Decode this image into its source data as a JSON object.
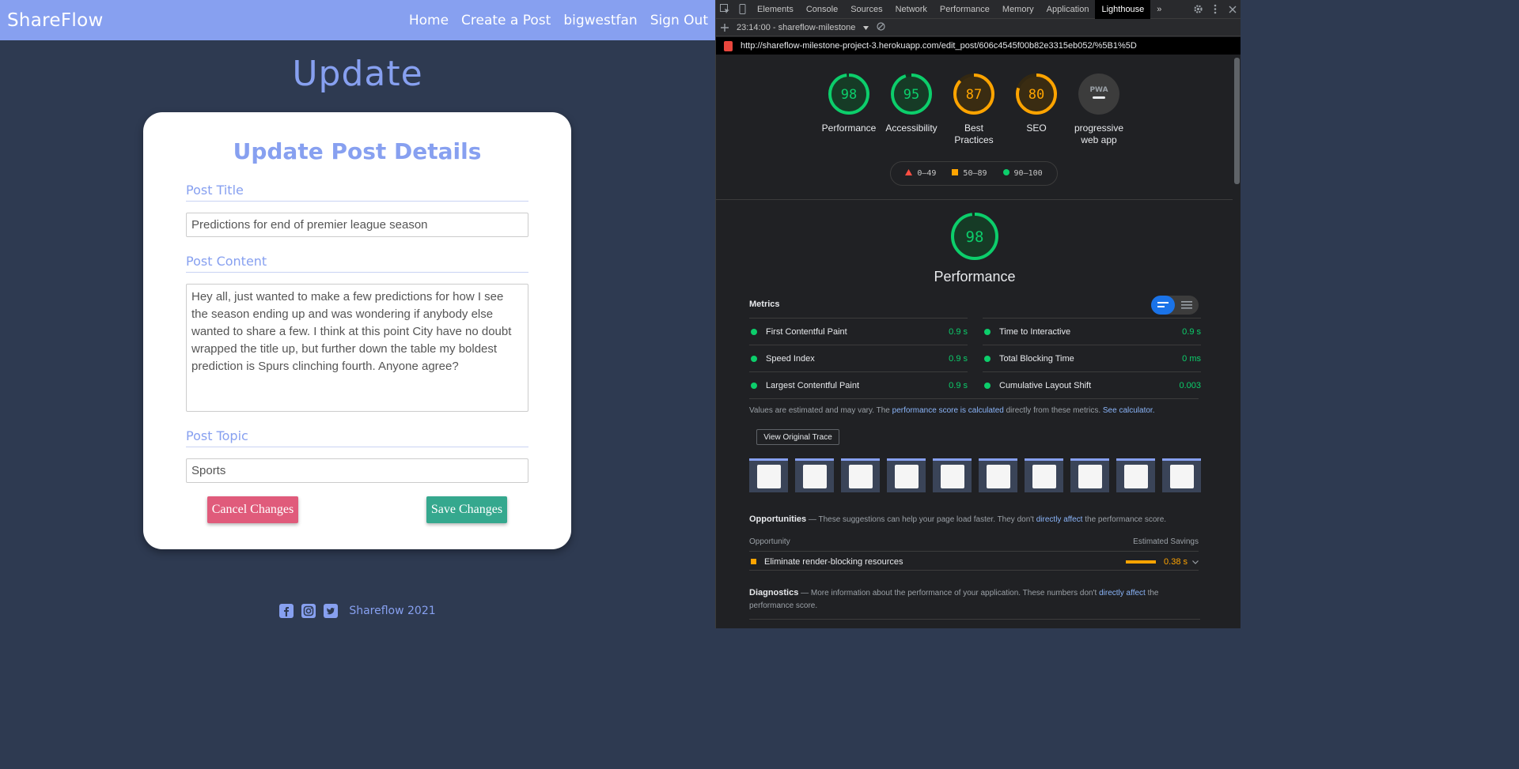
{
  "site": {
    "brand": "ShareFlow",
    "nav": [
      "Home",
      "Create a Post",
      "bigwestfan",
      "Sign Out"
    ],
    "heading": "Update",
    "card_title": "Update Post Details",
    "fields": {
      "title_label": "Post Title",
      "title_value": "Predictions for end of premier league season",
      "content_label": "Post Content",
      "content_value": "Hey all, just wanted to make a few predictions for how I see the season ending up and was wondering if anybody else wanted to share a few. I think at this point City have no doubt wrapped the title up, but further down the table my boldest prediction is Spurs clinching fourth. Anyone agree?",
      "topic_label": "Post Topic",
      "topic_value": "Sports"
    },
    "buttons": {
      "cancel": "Cancel Changes",
      "save": "Save Changes"
    },
    "footer": {
      "text": "Shareflow 2021",
      "icons": [
        "facebook-icon",
        "instagram-icon",
        "twitter-icon"
      ]
    },
    "colors": {
      "accent": "#87a0f0",
      "background": "#2e3a51",
      "cancel": "#e05b7b",
      "save": "#35a88e"
    }
  },
  "devtools": {
    "tabs": [
      "Elements",
      "Console",
      "Sources",
      "Network",
      "Performance",
      "Memory",
      "Application",
      "Lighthouse"
    ],
    "active_tab": "Lighthouse",
    "overflow": "»",
    "report_select": "23:14:00 - shareflow-milestone",
    "url": "http://shareflow-milestone-project-3.herokuapp.com/edit_post/606c4545f00b82e3315eb052/%5B1%5D",
    "scores": [
      {
        "name": "Performance",
        "value": 98,
        "color": "#0cce6b"
      },
      {
        "name": "Accessibility",
        "value": 95,
        "color": "#0cce6b"
      },
      {
        "name": "Best Practices",
        "value": 87,
        "color": "#ffa400"
      },
      {
        "name": "SEO",
        "value": 80,
        "color": "#ffa400"
      },
      {
        "name": "progressive web app",
        "value": "PWA",
        "color": "#9aa0a6"
      }
    ],
    "legend": [
      "0–49",
      "50–89",
      "90–100"
    ],
    "performance": {
      "score": 98,
      "title": "Performance",
      "metrics_heading": "Metrics",
      "metrics": [
        {
          "name": "First Contentful Paint",
          "value": "0.9 s"
        },
        {
          "name": "Time to Interactive",
          "value": "0.9 s"
        },
        {
          "name": "Speed Index",
          "value": "0.9 s"
        },
        {
          "name": "Total Blocking Time",
          "value": "0 ms"
        },
        {
          "name": "Largest Contentful Paint",
          "value": "0.9 s"
        },
        {
          "name": "Cumulative Layout Shift",
          "value": "0.003"
        }
      ],
      "note_pre": "Values are estimated and may vary. The ",
      "note_link1": "performance score is calculated",
      "note_mid": " directly from these metrics. ",
      "note_link2": "See calculator.",
      "trace_button": "View Original Trace",
      "opportunities_heading": "Opportunities",
      "opportunities_pre": " — These suggestions can help your page load faster. They don't ",
      "opportunities_link": "directly affect",
      "opportunities_post": " the performance score.",
      "opportunity_col": "Opportunity",
      "savings_col": "Estimated Savings",
      "opportunity_item": "Eliminate render-blocking resources",
      "opportunity_value": "0.38 s",
      "diagnostics_heading": "Diagnostics",
      "diagnostics_pre": " — More information about the performance of your application. These numbers don't ",
      "diagnostics_link": "directly affect",
      "diagnostics_post": " the performance score."
    }
  }
}
